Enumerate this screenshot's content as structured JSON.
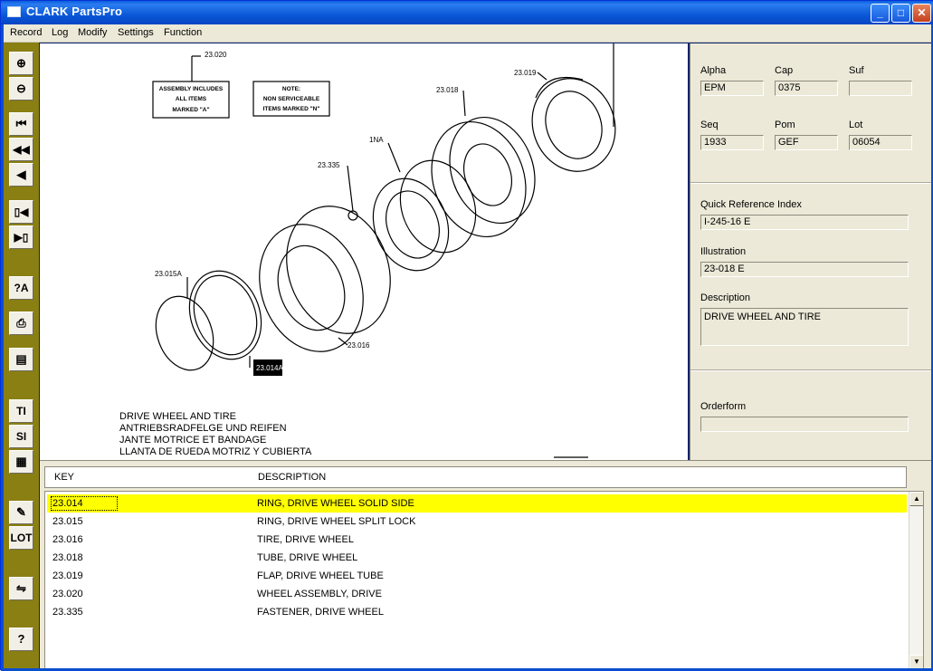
{
  "window": {
    "title": "CLARK PartsPro",
    "minimize": "_",
    "maximize": "□",
    "close": "✕"
  },
  "menu": [
    "Record",
    "Log",
    "Modify",
    "Settings",
    "Function"
  ],
  "toolbar": [
    {
      "name": "zoom-in-icon",
      "glyph": "⊕"
    },
    {
      "name": "zoom-out-icon",
      "glyph": "⊖"
    },
    {
      "name": "first-record-icon",
      "glyph": "⏮"
    },
    {
      "name": "rewind-icon",
      "glyph": "◀◀"
    },
    {
      "name": "previous-icon",
      "glyph": "◀"
    },
    {
      "name": "page-back-icon",
      "glyph": "▯◀"
    },
    {
      "name": "page-forward-icon",
      "glyph": "▶▯"
    },
    {
      "name": "help-lookup-icon",
      "glyph": "?A"
    },
    {
      "name": "print-icon",
      "glyph": "⎙"
    },
    {
      "name": "save-icon",
      "glyph": "▤"
    },
    {
      "name": "ti-button",
      "glyph": "TI"
    },
    {
      "name": "si-button",
      "glyph": "SI"
    },
    {
      "name": "clipboard-icon",
      "glyph": "▦"
    },
    {
      "name": "edit-note-icon",
      "glyph": "✎"
    },
    {
      "name": "lot-button",
      "glyph": "LOT"
    },
    {
      "name": "document-compare-icon",
      "glyph": "⇋"
    },
    {
      "name": "help-icon",
      "glyph": "?"
    }
  ],
  "illustration": {
    "callouts": [
      "23.020",
      "23.019",
      "23.018",
      "1NA",
      "23.335",
      "23.015A",
      "23.016",
      "23.014A"
    ],
    "note1": [
      "ASSEMBLY INCLUDES",
      "ALL ITEMS",
      "MARKED \"A\""
    ],
    "note2": [
      "NOTE:",
      "NON SERVICEABLE",
      "ITEMS MARKED \"N\""
    ],
    "caption": [
      "DRIVE WHEEL AND TIRE",
      "ANTRIEBSRADFELGE UND REIFEN",
      "JANTE MOTRICE ET BANDAGE",
      "LLANTA DE RUEDA MOTRIZ Y CUBIERTA"
    ]
  },
  "info": {
    "alpha_label": "Alpha",
    "alpha": "EPM",
    "cap_label": "Cap",
    "cap": "0375",
    "suf_label": "Suf",
    "suf": "",
    "seq_label": "Seq",
    "seq": "1933",
    "pom_label": "Pom",
    "pom": "GEF",
    "lot_label": "Lot",
    "lot": "06054",
    "qri_label": "Quick Reference Index",
    "qri": "I-245-16 E",
    "illustration_label": "Illustration",
    "illustration": "23-018   E",
    "description_label": "Description",
    "description": "DRIVE WHEEL AND TIRE",
    "orderform_label": "Orderform",
    "orderform": ""
  },
  "parts_list": {
    "key_header": "KEY",
    "description_header": "DESCRIPTION",
    "rows": [
      {
        "key": "23.014",
        "description": "RING, DRIVE WHEEL SOLID SIDE"
      },
      {
        "key": "23.015",
        "description": "RING, DRIVE WHEEL SPLIT LOCK"
      },
      {
        "key": "23.016",
        "description": "TIRE, DRIVE WHEEL"
      },
      {
        "key": "23.018",
        "description": "TUBE, DRIVE WHEEL"
      },
      {
        "key": "23.019",
        "description": "FLAP, DRIVE WHEEL TUBE"
      },
      {
        "key": "23.020",
        "description": "WHEEL ASSEMBLY, DRIVE"
      },
      {
        "key": "23.335",
        "description": "FASTENER, DRIVE WHEEL"
      }
    ],
    "selected_index": 0,
    "scroll_up": "▲",
    "scroll_down": "▼"
  },
  "colors": {
    "selection": "#ffff00",
    "toolbar": "#8a7f12",
    "titlebar": "#0a58d8"
  }
}
